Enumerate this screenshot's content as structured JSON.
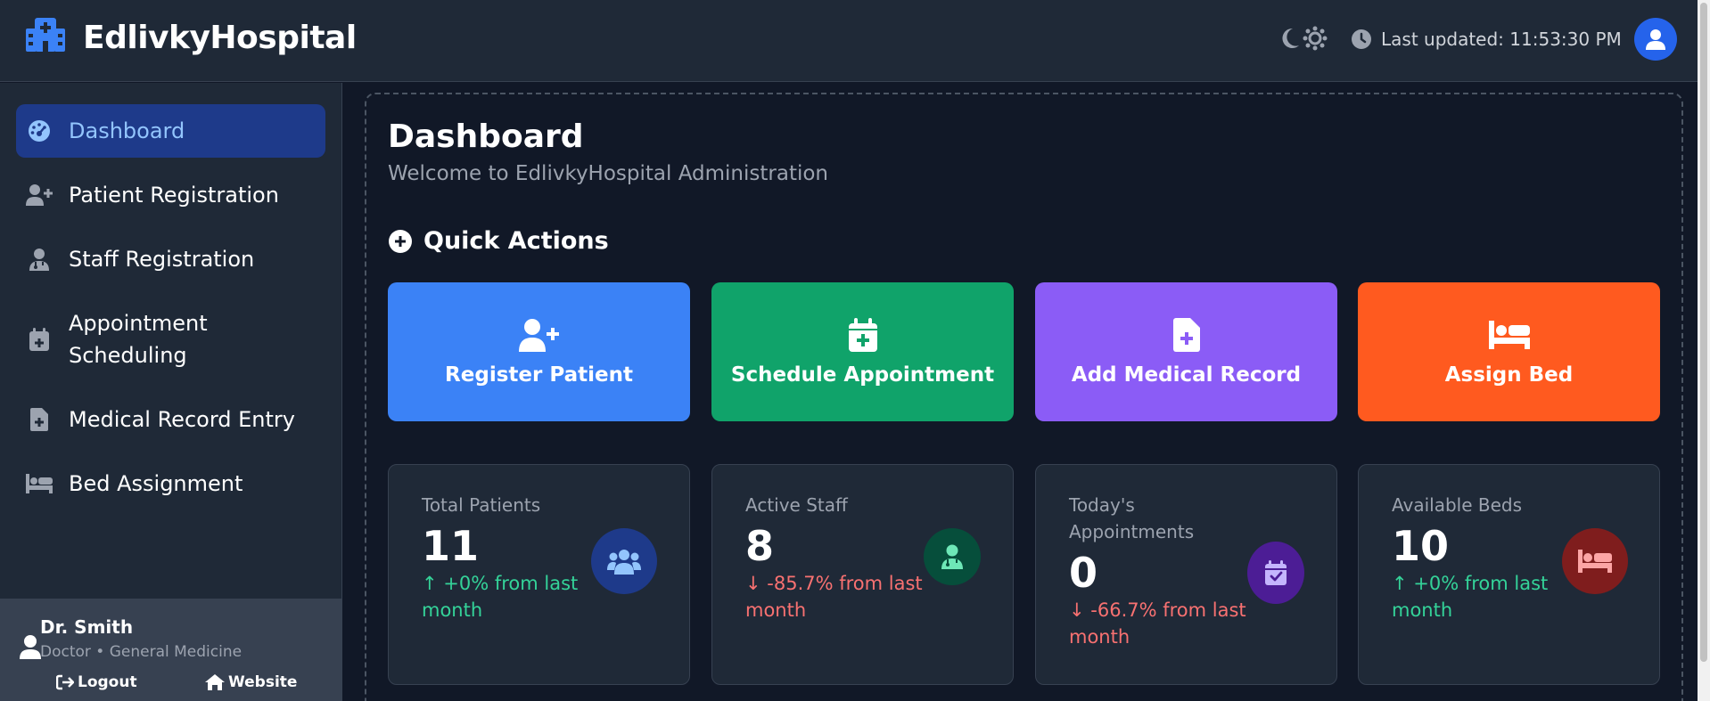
{
  "header": {
    "brand": "EdlivkyHospital",
    "last_updated": "Last updated: 11:53:30 PM",
    "icons": [
      "hospital-icon",
      "moon-icon",
      "sun-icon",
      "clock-icon",
      "user-icon"
    ]
  },
  "sidebar": {
    "items": [
      {
        "label": "Dashboard",
        "icon": "gauge-icon",
        "active": true
      },
      {
        "label": "Patient Registration",
        "icon": "user-plus-icon"
      },
      {
        "label": "Staff Registration",
        "icon": "user-doctor-icon"
      },
      {
        "label": "Appointment Scheduling",
        "label_line1": "Appointment",
        "label_line2": "Scheduling",
        "icon": "calendar-plus-icon"
      },
      {
        "label": "Medical Record Entry",
        "icon": "file-medical-icon"
      },
      {
        "label": "Bed Assignment",
        "icon": "bed-icon"
      }
    ],
    "user": {
      "name": "Dr. Smith",
      "role": "Doctor • General Medicine",
      "logout_label": "Logout",
      "website_label": "Website"
    }
  },
  "main": {
    "title": "Dashboard",
    "subtitle": "Welcome to EdlivkyHospital Administration",
    "quick_actions": {
      "heading": "Quick Actions",
      "items": [
        {
          "label": "Register Patient",
          "icon": "user-plus-icon",
          "color": "#3b82f6"
        },
        {
          "label": "Schedule Appointment",
          "icon": "calendar-plus-icon",
          "color": "#10a36a"
        },
        {
          "label": "Add Medical Record",
          "icon": "file-medical-icon",
          "color": "#8b5cf6"
        },
        {
          "label": "Assign Bed",
          "icon": "bed-icon",
          "color": "#ff5a1f"
        }
      ]
    },
    "stats": [
      {
        "label": "Total Patients",
        "value": "11",
        "change": "+0% from last month",
        "trend": "up",
        "icon": "users-icon",
        "icon_bg": "#1e3a8a",
        "icon_color": "#93c5fd"
      },
      {
        "label": "Active Staff",
        "value": "8",
        "change": "-85.7% from last month",
        "trend": "down",
        "icon": "user-doctor-icon",
        "icon_bg": "#064e3b",
        "icon_color": "#6ee7b7"
      },
      {
        "label": "Today's Appointments",
        "label_line1": "Today's",
        "label_line2": "Appointments",
        "value": "0",
        "change": "-66.7% from last month",
        "trend": "down",
        "icon": "calendar-check-icon",
        "icon_bg": "#4c1d95",
        "icon_color": "#c4b5fd"
      },
      {
        "label": "Available Beds",
        "value": "10",
        "change": "+0% from last month",
        "trend": "up",
        "icon": "bed-icon",
        "icon_bg": "#7f1d1d",
        "icon_color": "#fca5a5"
      }
    ]
  },
  "colors": {
    "background": "#111827",
    "panel": "#1f2937",
    "accent": "#2563eb",
    "positive": "#34d399",
    "negative": "#f87171"
  }
}
